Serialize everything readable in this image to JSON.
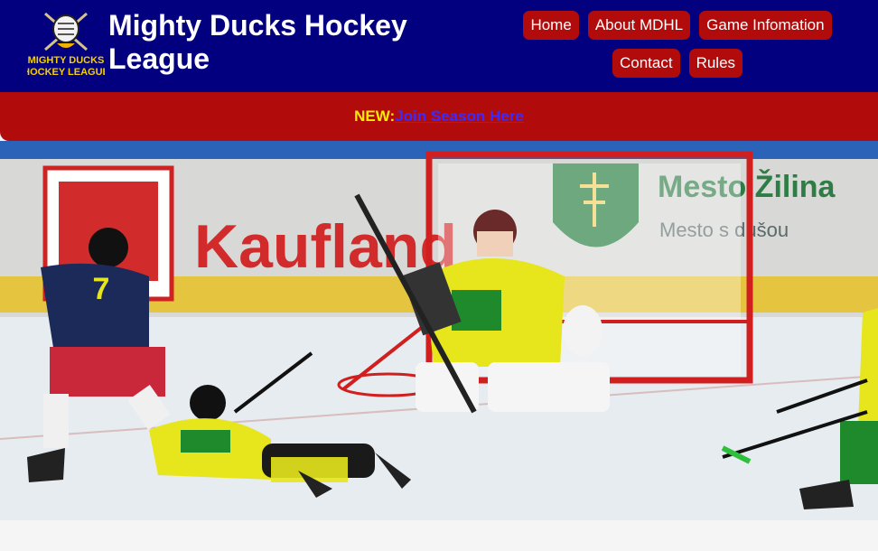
{
  "header": {
    "logo_alt": "Mighty Ducks Hockey League logo",
    "logo_lines": [
      "MIGHTY DUCKS",
      "HOCKEY LEAGUE"
    ],
    "title_line1": "Mighty Ducks Hockey",
    "title_line2": "League"
  },
  "nav": {
    "items": [
      {
        "label": "Home"
      },
      {
        "label": "About MDHL"
      },
      {
        "label": "Game Infomation"
      },
      {
        "label": "Contact"
      },
      {
        "label": "Rules"
      }
    ]
  },
  "banner": {
    "prefix": "NEW:",
    "link_text": "Join Season Here"
  },
  "hero": {
    "alt": "Youth hockey game: goalie in yellow-green guarding the red net while players in navy and yellow-green jerseys chase the puck",
    "rink_ads": [
      "Kaufland",
      "Mesto Žilina",
      "Mesto s dušou"
    ],
    "player_number": "7",
    "colors": {
      "rink_ice": "#e6ecef",
      "boards": "#d9d9d9",
      "net_frame": "#d11f1f",
      "team_yellow": "#e7e51c",
      "team_green": "#1f8a2c",
      "team_navy": "#1c2a5a"
    }
  },
  "colors": {
    "header_bg": "#02007f",
    "nav_button_bg": "#b10b0b",
    "banner_bg": "#b10b0b",
    "banner_new": "#ffea00",
    "banner_link": "#3a2cff"
  }
}
